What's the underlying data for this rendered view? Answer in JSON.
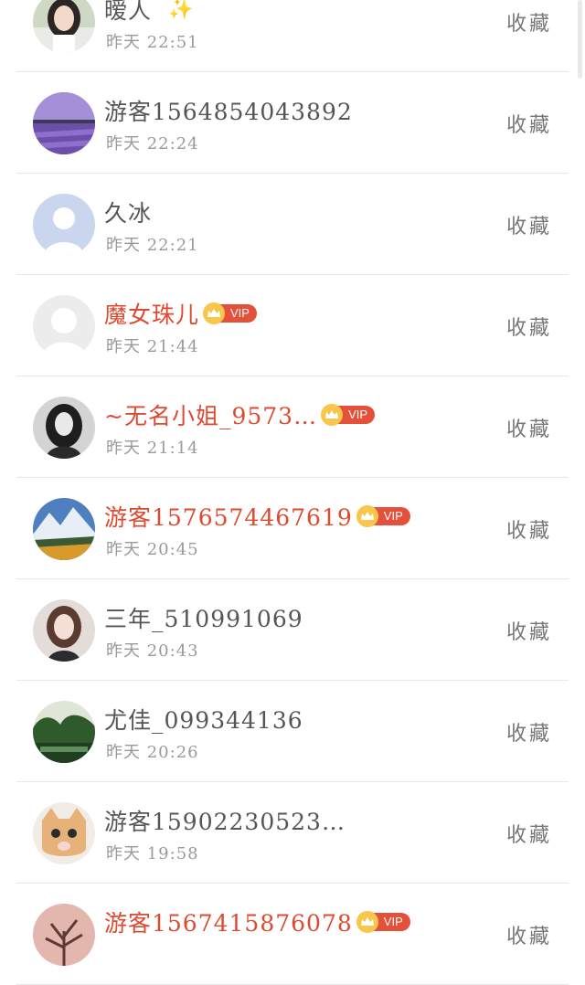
{
  "favorite_label": "收藏",
  "vip_label": "VIP",
  "accent_color": "#dd4a30",
  "items": [
    {
      "name": "暧人",
      "time": "昨天 22:51",
      "vip": false,
      "sparkle": "✨",
      "avatar": "girl-portrait-avatar"
    },
    {
      "name": "游客1564854043892",
      "time": "昨天 22:24",
      "vip": false,
      "avatar": "lavender-field-avatar"
    },
    {
      "name": "久冰",
      "time": "昨天 22:21",
      "vip": false,
      "avatar": "default-blue-avatar"
    },
    {
      "name": "魔女珠儿",
      "time": "昨天 21:44",
      "vip": true,
      "avatar": "default-grey-avatar"
    },
    {
      "name": "~无名小姐_9573…",
      "time": "昨天 21:14",
      "vip": true,
      "avatar": "dark-girl-avatar"
    },
    {
      "name": "游客1576574467619",
      "time": "昨天 20:45",
      "vip": true,
      "avatar": "mountain-avatar"
    },
    {
      "name": "三年_510991069",
      "time": "昨天 20:43",
      "vip": false,
      "avatar": "woman-portrait-avatar"
    },
    {
      "name": "尤佳_099344136",
      "time": "昨天 20:26",
      "vip": false,
      "avatar": "garden-avatar"
    },
    {
      "name": "游客15902230523…",
      "time": "昨天 19:58",
      "vip": false,
      "avatar": "kitten-avatar"
    },
    {
      "name": "游客1567415876078",
      "time": "",
      "vip": true,
      "avatar": "tree-sunset-avatar"
    }
  ]
}
